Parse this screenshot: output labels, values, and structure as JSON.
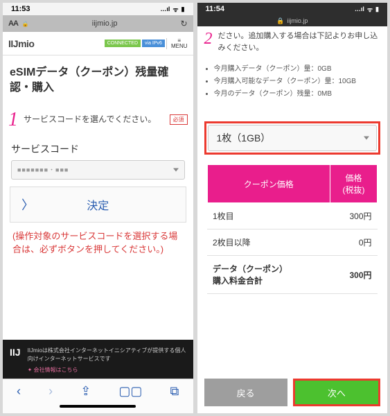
{
  "left": {
    "status": {
      "time": "11:53",
      "signal": "…ıl",
      "wifi": "ᯤ",
      "battery": "▮"
    },
    "url": {
      "aa": "AA",
      "lock": "🔒",
      "domain": "iijmio.jp",
      "reload": "↻"
    },
    "header": {
      "logo": "IIJmio",
      "badge1": "CONNECTED",
      "badge2": "via IPv6",
      "menu": "≡\nMENU"
    },
    "title": "eSIMデータ（クーポン）残量確認・購入",
    "step1": {
      "num": "1",
      "text": "サービスコードを選んでください。",
      "req": "必須"
    },
    "field_label": "サービスコード",
    "select_masked": "■■■■■■■・■■■",
    "decide": "決定",
    "warning": "(操作対象のサービスコードを選択する場合は、必ずボタンを押してください。)",
    "footer": {
      "logo": "IIJ",
      "line1": "IIJmioは株式会社インターネットイニシアティブが提供する個人向けインターネットサービスです",
      "line2": "✦ 会社情報はこちら"
    },
    "toolbar": {
      "back": "‹",
      "fwd": "›",
      "share": "⇪",
      "book": "▢▢",
      "tabs": "⧉"
    }
  },
  "right": {
    "status": {
      "time": "11:54",
      "signal": "…ıl",
      "wifi": "ᯤ",
      "battery": "▮"
    },
    "url": {
      "lock": "🔒",
      "domain": "iijmio.jp"
    },
    "top": {
      "num": "2",
      "text": "ださい。追加購入する場合は下記よりお申し込みください。"
    },
    "bullets": [
      "今月購入データ（クーポン）量：0GB",
      "今月購入可能なデータ（クーポン）量：10GB",
      "今月のデータ（クーポン）残量：0MB"
    ],
    "qty": "1枚（1GB）",
    "table": {
      "h1": "クーポン価格",
      "h2": "価格\n(税抜)",
      "rows": [
        {
          "label": "1枚目",
          "price": "300円"
        },
        {
          "label": "2枚目以降",
          "price": "0円"
        },
        {
          "label": "データ（クーポン）\n購入料金合計",
          "price": "300円"
        }
      ]
    },
    "buttons": {
      "back": "戻る",
      "next": "次へ"
    }
  }
}
